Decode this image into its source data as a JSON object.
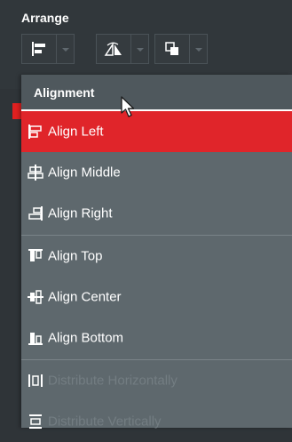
{
  "panel": {
    "title": "Arrange"
  },
  "toolbar": {
    "buttons": [
      {
        "icon": "align-left-icon"
      },
      {
        "icon": "flip-icon"
      },
      {
        "icon": "arrange-order-icon"
      }
    ]
  },
  "menu": {
    "header": "Alignment",
    "items": [
      {
        "label": "Align Left",
        "icon": "align-left-icon",
        "state": "highlighted"
      },
      {
        "label": "Align Middle",
        "icon": "align-middle-icon",
        "state": "normal"
      },
      {
        "label": "Align Right",
        "icon": "align-right-icon",
        "state": "normal"
      },
      {
        "label": "Align Top",
        "icon": "align-top-icon",
        "state": "normal"
      },
      {
        "label": "Align Center",
        "icon": "align-center-icon",
        "state": "normal"
      },
      {
        "label": "Align Bottom",
        "icon": "align-bottom-icon",
        "state": "normal"
      },
      {
        "label": "Distribute Horizontally",
        "icon": "distribute-horizontally-icon",
        "state": "disabled"
      },
      {
        "label": "Distribute Vertically",
        "icon": "distribute-vertically-icon",
        "state": "disabled"
      }
    ]
  },
  "colors": {
    "highlight": "#e0252a",
    "menu_bg": "#5e686d",
    "panel_bg": "#31373b",
    "disabled_text": "#737d82"
  }
}
